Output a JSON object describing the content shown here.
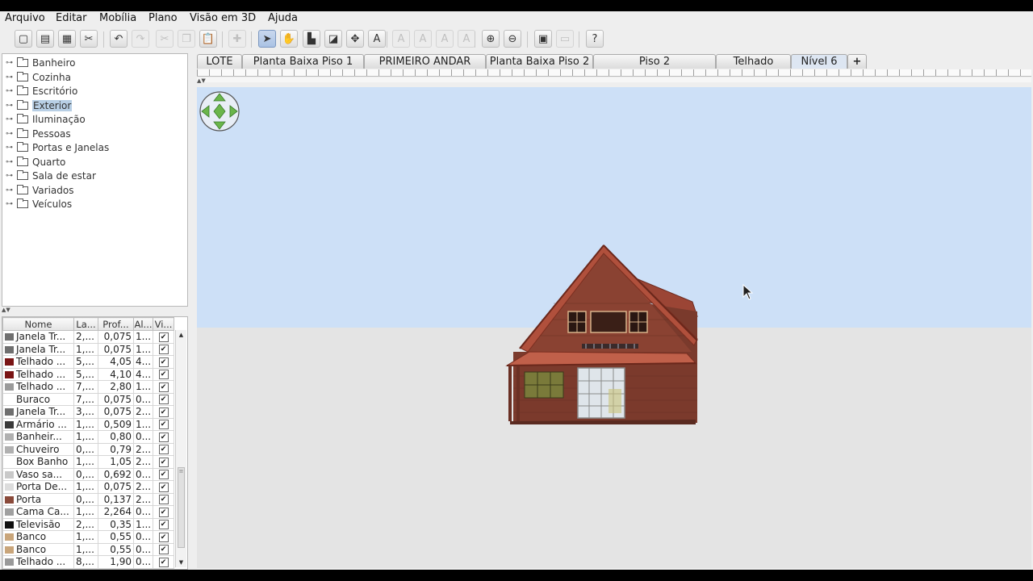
{
  "menu": [
    "Arquivo",
    "Editar",
    "Mobília",
    "Plano",
    "Visão em 3D",
    "Ajuda"
  ],
  "toolbar": {
    "buttons": [
      {
        "name": "new-icon",
        "glyph": "▢",
        "state": "normal"
      },
      {
        "name": "open-icon",
        "glyph": "▤",
        "state": "normal"
      },
      {
        "name": "save-icon",
        "glyph": "▦",
        "state": "normal"
      },
      {
        "name": "preferences-icon",
        "glyph": "✂",
        "state": "normal"
      },
      {
        "name": "undo-icon",
        "glyph": "↶",
        "state": "normal"
      },
      {
        "name": "redo-icon",
        "glyph": "↷",
        "state": "disabled"
      },
      {
        "name": "cut-icon",
        "glyph": "✂",
        "state": "disabled"
      },
      {
        "name": "copy-icon",
        "glyph": "❐",
        "state": "disabled"
      },
      {
        "name": "paste-icon",
        "glyph": "📋",
        "state": "normal"
      },
      {
        "name": "add-furniture-icon",
        "glyph": "✚",
        "state": "disabled"
      },
      {
        "name": "select-icon",
        "glyph": "➤",
        "state": "selected"
      },
      {
        "name": "pan-icon",
        "glyph": "✋",
        "state": "normal"
      },
      {
        "name": "create-walls-icon",
        "glyph": "▙",
        "state": "normal"
      },
      {
        "name": "create-rooms-icon",
        "glyph": "◪",
        "state": "normal"
      },
      {
        "name": "create-dimensions-icon",
        "glyph": "✥",
        "state": "normal"
      },
      {
        "name": "add-text-icon",
        "glyph": "A",
        "state": "normal"
      },
      {
        "name": "increase-text-icon",
        "glyph": "A",
        "state": "disabled"
      },
      {
        "name": "decrease-text-icon",
        "glyph": "A",
        "state": "disabled"
      },
      {
        "name": "bold-text-icon",
        "glyph": "A",
        "state": "disabled"
      },
      {
        "name": "italic-text-icon",
        "glyph": "A",
        "state": "disabled"
      },
      {
        "name": "zoom-in-icon",
        "glyph": "⊕",
        "state": "normal"
      },
      {
        "name": "zoom-out-icon",
        "glyph": "⊖",
        "state": "normal"
      },
      {
        "name": "photo-icon",
        "glyph": "▣",
        "state": "normal"
      },
      {
        "name": "video-icon",
        "glyph": "▭",
        "state": "disabled"
      },
      {
        "name": "help-icon",
        "glyph": "?",
        "state": "normal"
      }
    ]
  },
  "catalog": {
    "categories": [
      "Banheiro",
      "Cozinha",
      "Escritório",
      "Exterior",
      "Iluminação",
      "Pessoas",
      "Portas e Janelas",
      "Quarto",
      "Sala de estar",
      "Variados",
      "Veículos"
    ],
    "selected": "Exterior"
  },
  "furniture": {
    "columns": [
      "Nome",
      "La...",
      "Prof...",
      "Al...",
      "Vi..."
    ],
    "rows": [
      {
        "icon": "#6f6f6f",
        "name": "Janela Tr...",
        "width": "2,...",
        "depth": "0,075",
        "height": "1...",
        "visible": "✔"
      },
      {
        "icon": "#6f6f6f",
        "name": "Janela Tr...",
        "width": "1,...",
        "depth": "0,075",
        "height": "1...",
        "visible": "✔"
      },
      {
        "icon": "#7a1414",
        "name": "Telhado ...",
        "width": "5,...",
        "depth": "4,05",
        "height": "4...",
        "visible": "✔"
      },
      {
        "icon": "#7a1414",
        "name": "Telhado ...",
        "width": "5,...",
        "depth": "4,10",
        "height": "4...",
        "visible": "✔"
      },
      {
        "icon": "#9a9a9a",
        "name": "Telhado ...",
        "width": "7,...",
        "depth": "2,80",
        "height": "1...",
        "visible": "✔"
      },
      {
        "icon": "#ffffff",
        "name": "Buraco",
        "width": "7,...",
        "depth": "0,075",
        "height": "0...",
        "visible": "✔"
      },
      {
        "icon": "#6f6f6f",
        "name": "Janela Tr...",
        "width": "3,...",
        "depth": "0,075",
        "height": "2...",
        "visible": "✔"
      },
      {
        "icon": "#3a3a3a",
        "name": "Armário ...",
        "width": "1,...",
        "depth": "0,509",
        "height": "1...",
        "visible": "✔"
      },
      {
        "icon": "#b0b0b0",
        "name": "Banheir...",
        "width": "1,...",
        "depth": "0,80",
        "height": "0...",
        "visible": "✔"
      },
      {
        "icon": "#b0b0b0",
        "name": "Chuveiro",
        "width": "0,...",
        "depth": "0,79",
        "height": "2...",
        "visible": "✔"
      },
      {
        "icon": "#ffffff",
        "name": "Box Banho",
        "width": "1,...",
        "depth": "1,05",
        "height": "2...",
        "visible": "✔"
      },
      {
        "icon": "#c9c9c9",
        "name": "Vaso sa...",
        "width": "0,...",
        "depth": "0,692",
        "height": "0...",
        "visible": "✔"
      },
      {
        "icon": "#dcdcdc",
        "name": "Porta De...",
        "width": "1,...",
        "depth": "0,075",
        "height": "2...",
        "visible": "✔"
      },
      {
        "icon": "#8a4a3a",
        "name": "Porta",
        "width": "0,...",
        "depth": "0,137",
        "height": "2...",
        "visible": "✔"
      },
      {
        "icon": "#a0a0a0",
        "name": "Cama Ca...",
        "width": "1,...",
        "depth": "2,264",
        "height": "0...",
        "visible": "✔"
      },
      {
        "icon": "#111111",
        "name": "Televisão",
        "width": "2,...",
        "depth": "0,35",
        "height": "1...",
        "visible": "✔"
      },
      {
        "icon": "#c9a57a",
        "name": "Banco",
        "width": "1,...",
        "depth": "0,55",
        "height": "0...",
        "visible": "✔"
      },
      {
        "icon": "#c9a57a",
        "name": "Banco",
        "width": "1,...",
        "depth": "0,55",
        "height": "0...",
        "visible": "✔"
      },
      {
        "icon": "#9a9a9a",
        "name": "Telhado ...",
        "width": "8,...",
        "depth": "1,90",
        "height": "0...",
        "visible": "✔"
      }
    ]
  },
  "levels": {
    "tabs": [
      "LOTE",
      "Planta Baixa Piso 1",
      "PRIMEIRO ANDAR",
      "Planta Baixa Piso 2",
      "Piso 2",
      "Telhado",
      "Nível 6",
      "+"
    ],
    "active": "Nível 6"
  },
  "view3d": {
    "sky_color": "#cde0f7",
    "ground_color": "#e4e4e4"
  }
}
